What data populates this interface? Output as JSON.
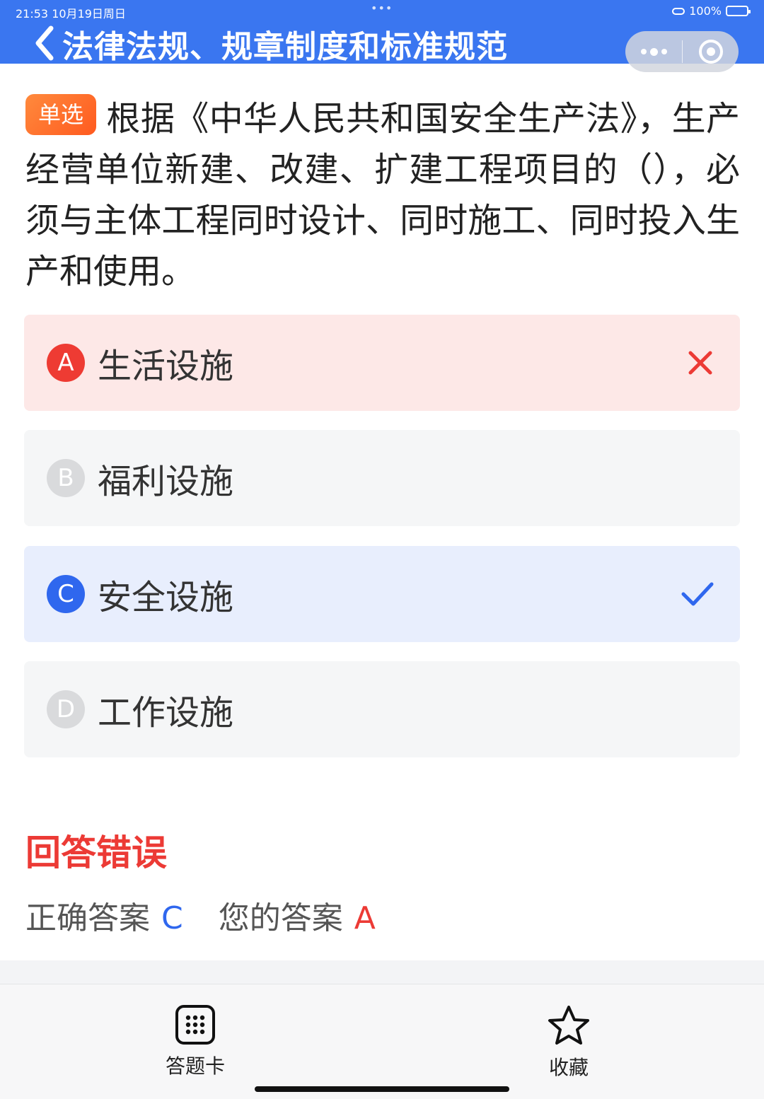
{
  "status_bar": {
    "time": "21:53 10月19日周日",
    "dots": "•••",
    "battery": "100%"
  },
  "header": {
    "title": "法律法规、规章制度和标准规范"
  },
  "question": {
    "type_tag": "单选",
    "text": "根据《中华人民共和国安全生产法》，生产经营单位新建、改建、扩建工程项目的（），必须与主体工程同时设计、同时施工、同时投入生产和使用。"
  },
  "options": [
    {
      "letter": "A",
      "text": "生活设施",
      "state": "wrong"
    },
    {
      "letter": "B",
      "text": "福利设施",
      "state": "normal"
    },
    {
      "letter": "C",
      "text": "安全设施",
      "state": "correct"
    },
    {
      "letter": "D",
      "text": "工作设施",
      "state": "normal"
    }
  ],
  "result": {
    "title": "回答错误",
    "correct_label": "正确答案",
    "correct_value": "C",
    "yours_label": "您的答案",
    "yours_value": "A"
  },
  "bottom_bar": {
    "answer_card_label": "答题卡",
    "favorite_label": "收藏"
  },
  "colors": {
    "header_blue": "#3a76f0",
    "wrong_red": "#ec3a35",
    "correct_blue": "#2f67ee",
    "tag_orange": "#ff6a2a"
  },
  "icons": {
    "back": "back-arrow-icon",
    "more": "more-dots-icon",
    "close": "close-circle-icon",
    "wrong": "cross-icon",
    "correct": "check-icon",
    "answer_card": "grid-icon",
    "favorite": "star-icon"
  }
}
